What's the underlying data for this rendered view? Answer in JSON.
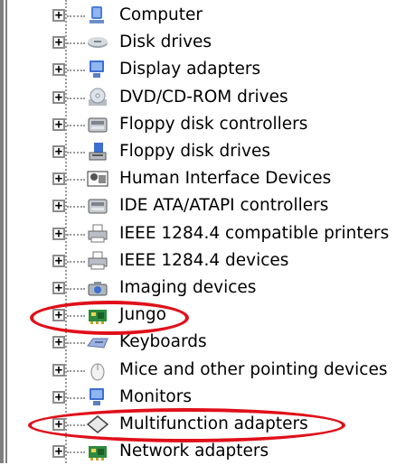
{
  "tree": {
    "items": [
      {
        "label": "Computer",
        "icon": "computer-icon"
      },
      {
        "label": "Disk drives",
        "icon": "disk-drive-icon"
      },
      {
        "label": "Display adapters",
        "icon": "display-adapter-icon"
      },
      {
        "label": "DVD/CD-ROM drives",
        "icon": "dvd-drive-icon"
      },
      {
        "label": "Floppy disk controllers",
        "icon": "floppy-controller-icon"
      },
      {
        "label": "Floppy disk drives",
        "icon": "floppy-drive-icon"
      },
      {
        "label": "Human Interface Devices",
        "icon": "hid-icon"
      },
      {
        "label": "IDE ATA/ATAPI controllers",
        "icon": "ide-controller-icon"
      },
      {
        "label": "IEEE 1284.4 compatible printers",
        "icon": "printer-icon"
      },
      {
        "label": "IEEE 1284.4 devices",
        "icon": "printer-icon"
      },
      {
        "label": "Imaging devices",
        "icon": "camera-icon"
      },
      {
        "label": "Jungo",
        "icon": "circuit-board-icon"
      },
      {
        "label": "Keyboards",
        "icon": "keyboard-icon"
      },
      {
        "label": "Mice and other pointing devices",
        "icon": "mouse-icon"
      },
      {
        "label": "Monitors",
        "icon": "monitor-icon"
      },
      {
        "label": "Multifunction adapters",
        "icon": "multifunction-adapter-icon"
      },
      {
        "label": "Network adapters",
        "icon": "network-adapter-icon"
      }
    ],
    "expander_symbol": "+"
  },
  "highlighted_items": [
    "Jungo",
    "Multifunction adapters"
  ],
  "colors": {
    "highlight": "#e0101a",
    "tree_line": "#9a9a9a"
  }
}
